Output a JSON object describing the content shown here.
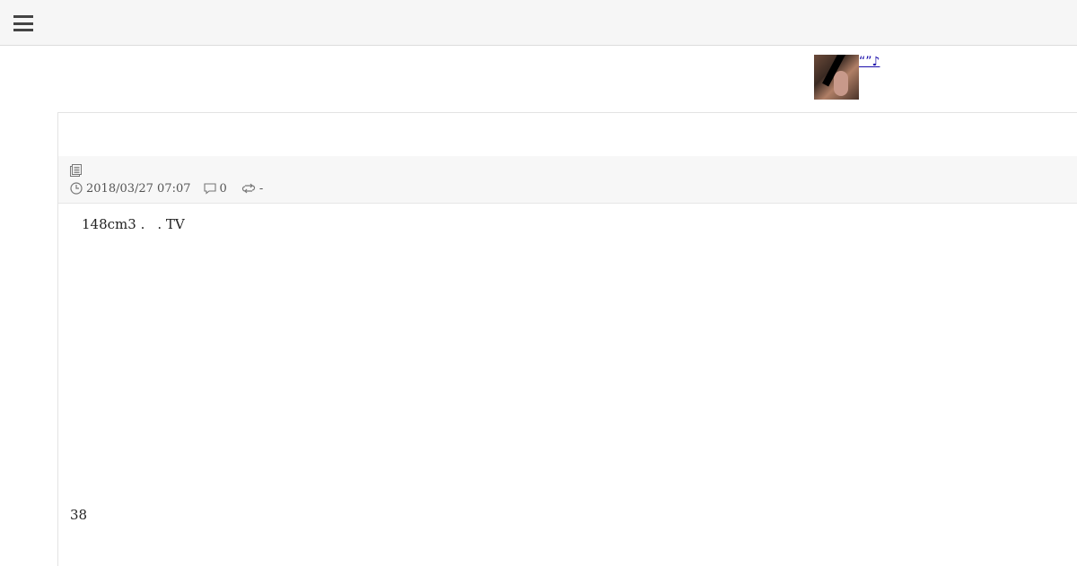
{
  "header": {
    "menu_icon": "hamburger-menu-icon"
  },
  "ad": {
    "thumbnail_icon": "ad-thumbnail-image",
    "link_text": "“”♪"
  },
  "post": {
    "doc_icon": "document-icon",
    "date": "2018/03/27 07:07",
    "comments_icon": "comment-icon",
    "comments_count": "0",
    "trackback_icon": "trackback-icon",
    "trackback_count": "-",
    "body_part1": "148cm3 .",
    "body_part2": ". TV",
    "footer_number": "38"
  }
}
